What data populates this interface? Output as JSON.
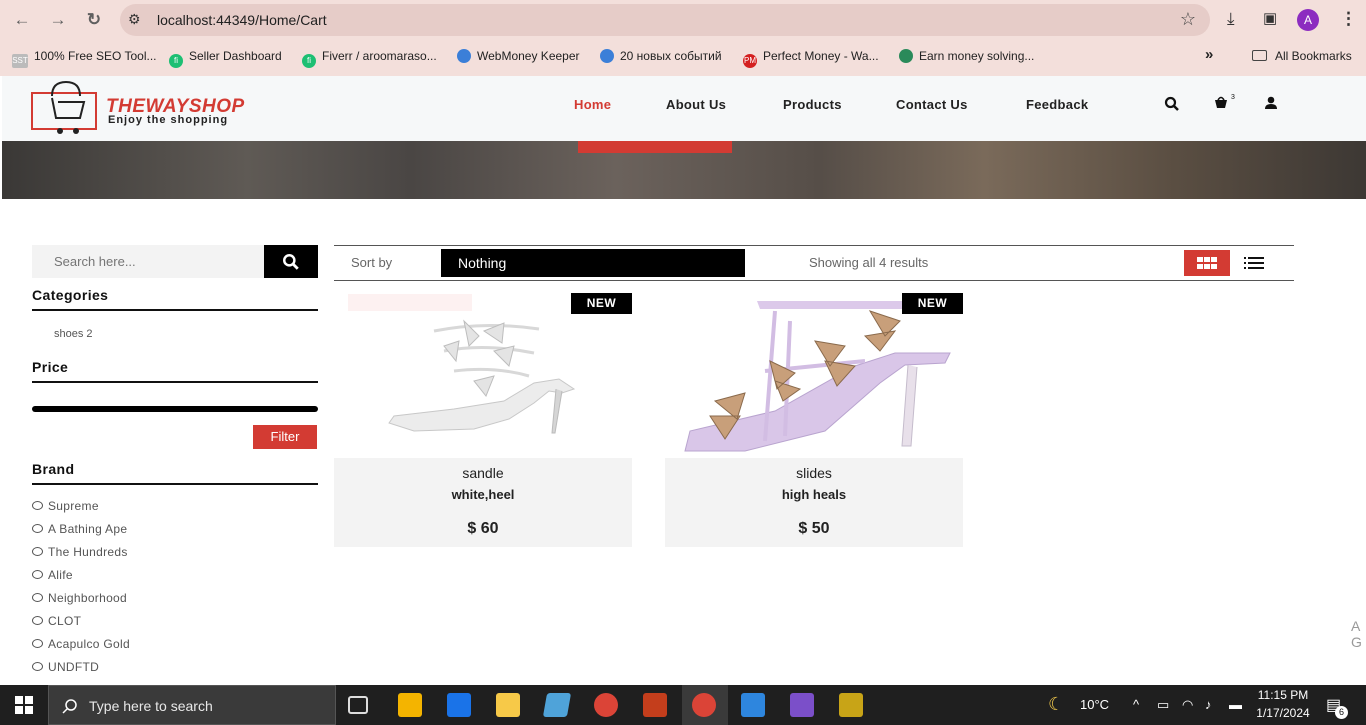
{
  "browser": {
    "url": "localhost:44349/Home/Cart",
    "bookmarks": [
      {
        "label": "100% Free SEO Tool...",
        "color": "#555555"
      },
      {
        "label": "Seller Dashboard",
        "color": "#1dbf73"
      },
      {
        "label": "Fiverr / aroomaraso...",
        "color": "#1dbf73"
      },
      {
        "label": "WebMoney Keeper",
        "color": "#3b7fd8"
      },
      {
        "label": "20 новых событий",
        "color": "#3b7fd8"
      },
      {
        "label": "Perfect Money - Wa...",
        "color": "#d42020"
      },
      {
        "label": "Earn money solving...",
        "color": "#2a8a5a"
      }
    ],
    "more_label": "»",
    "all_bookmarks": "All Bookmarks",
    "avatar_letter": "A"
  },
  "site": {
    "logo_name": "THEWAYSHOP",
    "logo_tagline": "Enjoy the shopping",
    "menu": [
      {
        "label": "Home",
        "active": true
      },
      {
        "label": "About Us"
      },
      {
        "label": "Products"
      },
      {
        "label": "Contact Us"
      },
      {
        "label": "Feedback"
      }
    ],
    "cart_count": "3",
    "accent": "#d33b33"
  },
  "sidebar": {
    "search_placeholder": "Search here...",
    "categories_title": "Categories",
    "categories": [
      "shoes 2"
    ],
    "price_title": "Price",
    "filter_label": "Filter",
    "brand_title": "Brand",
    "brands": [
      "Supreme",
      "A Bathing Ape",
      "The Hundreds",
      "Alife",
      "Neighborhood",
      "CLOT",
      "Acapulco Gold",
      "UNDFTD"
    ]
  },
  "toolbar": {
    "sort_label": "Sort by",
    "sort_value": "Nothing",
    "showing": "Showing all 4 results"
  },
  "products": [
    {
      "name": "sandle",
      "desc": "white,heel",
      "price": "$ 60",
      "badge": "NEW"
    },
    {
      "name": "slides",
      "desc": "high heals",
      "price": "$ 50",
      "badge": "NEW"
    }
  ],
  "scroll_hint": "A\nG",
  "taskbar": {
    "search_placeholder": "Type here to search",
    "weather": "10°C",
    "time": "11:15 PM",
    "date": "1/17/2024",
    "notifications": "6"
  }
}
